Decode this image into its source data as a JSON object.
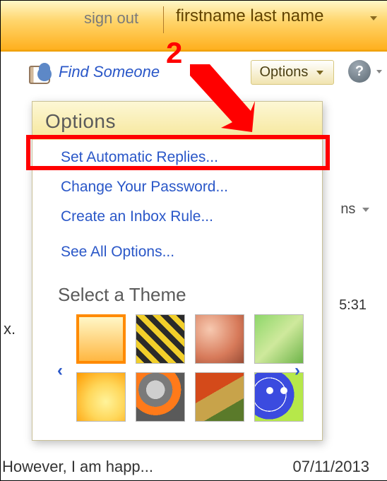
{
  "topbar": {
    "sign_out": "sign out",
    "user_name": "firstname last name"
  },
  "toolbar": {
    "find_someone": "Find Someone",
    "options_label": "Options",
    "help_glyph": "?"
  },
  "panel": {
    "title": "Options",
    "items": [
      "Set Automatic Replies...",
      "Change Your Password...",
      "Create an Inbox Rule...",
      "See All Options..."
    ],
    "theme_heading": "Select a Theme",
    "theme_count": 8,
    "selected_theme_index": 0
  },
  "background": {
    "ns_fragment": "ns",
    "time_fragment": "5:31",
    "x_fragment": "x."
  },
  "annotation": {
    "step": "2",
    "highlight_target": "menu-item-set-automatic-replies"
  },
  "footer": {
    "preview": "However, I am happ...",
    "date": "07/11/2013"
  },
  "colors": {
    "accent_orange": "#ffb120",
    "link_blue": "#2a57c8",
    "annotation_red": "#ff0000"
  }
}
